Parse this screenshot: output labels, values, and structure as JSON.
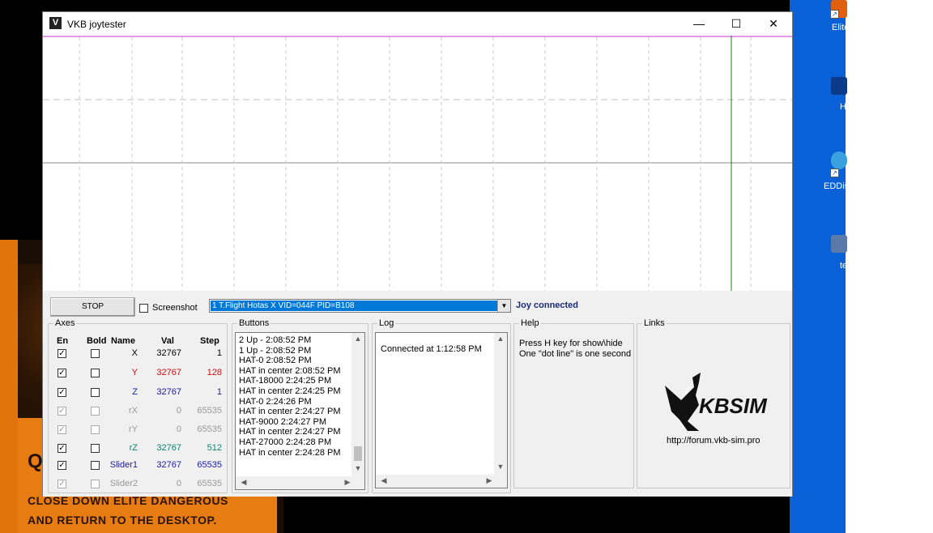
{
  "window": {
    "title": "VKB joytester",
    "minimize_glyph": "—",
    "maximize_glyph": "☐",
    "close_glyph": "✕"
  },
  "toolbar": {
    "stop_label": "STOP",
    "screenshot_label": "Screenshot",
    "screenshot_checked": false,
    "device_selected": "1 T.Flight Hotas X VID=044F PID=B108",
    "status_text": "Joy connected"
  },
  "axes": {
    "group_label": "Axes",
    "headers": {
      "en": "En",
      "bold": "Bold",
      "name": "Name",
      "val": "Val",
      "step": "Step"
    },
    "rows": [
      {
        "name": "X",
        "val": "32767",
        "step": "1",
        "enabled": true,
        "bold": false,
        "color": "#000000",
        "disabled": false
      },
      {
        "name": "Y",
        "val": "32767",
        "step": "128",
        "enabled": true,
        "bold": false,
        "color": "#d01010",
        "disabled": false
      },
      {
        "name": "Z",
        "val": "32767",
        "step": "1",
        "enabled": true,
        "bold": false,
        "color": "#1c1c9c",
        "disabled": false
      },
      {
        "name": "rX",
        "val": "0",
        "step": "65535",
        "enabled": true,
        "bold": false,
        "color": "#9a9a9a",
        "disabled": true
      },
      {
        "name": "rY",
        "val": "0",
        "step": "65535",
        "enabled": true,
        "bold": false,
        "color": "#9a9a9a",
        "disabled": true
      },
      {
        "name": "rZ",
        "val": "32767",
        "step": "512",
        "enabled": true,
        "bold": false,
        "color": "#108070",
        "disabled": false
      },
      {
        "name": "Slider1",
        "val": "32767",
        "step": "65535",
        "enabled": true,
        "bold": false,
        "color": "#1c1c9c",
        "disabled": false
      },
      {
        "name": "Slider2",
        "val": "0",
        "step": "65535",
        "enabled": true,
        "bold": false,
        "color": "#9a9a9a",
        "disabled": true
      }
    ]
  },
  "buttons": {
    "group_label": "Buttons",
    "entries": [
      "2 Up - 2:08:52 PM",
      "1 Up - 2:08:52 PM",
      "HAT-0 2:08:52 PM",
      "HAT in center 2:08:52 PM",
      "HAT-18000 2:24:25 PM",
      "HAT in center 2:24:25 PM",
      "HAT-0 2:24:26 PM",
      "HAT in center 2:24:27 PM",
      "HAT-9000 2:24:27 PM",
      "HAT in center 2:24:27 PM",
      "HAT-27000 2:24:28 PM",
      "HAT in center 2:24:28 PM"
    ]
  },
  "log": {
    "group_label": "Log",
    "entries": [
      "Connected at 1:12:58 PM"
    ]
  },
  "help": {
    "group_label": "Help",
    "lines": [
      "Press H key for show\\hide",
      "One \"dot line\" is one second"
    ]
  },
  "links": {
    "group_label": "Links",
    "logo_text": "KBSIM",
    "url": "http://forum.vkb-sim.pro"
  },
  "background": {
    "game_letter": "Q",
    "game_message_line1": "CLOSE DOWN ELITE DANGEROUS",
    "game_message_line2": "AND RETURN TO THE DESKTOP.",
    "desktop_icons": [
      {
        "label": "Elite",
        "color": "#e06010"
      },
      {
        "label": "H",
        "color": "#0b3a8a"
      },
      {
        "label": "EDDis",
        "color": "#3aa0e0"
      },
      {
        "label": "te",
        "color": "#5a7aaa"
      }
    ]
  },
  "colors": {
    "accent_select": "#0078d7",
    "status_text": "#1a2a70",
    "graph_top_line": "#d030d0",
    "graph_cursor": "#108010"
  }
}
